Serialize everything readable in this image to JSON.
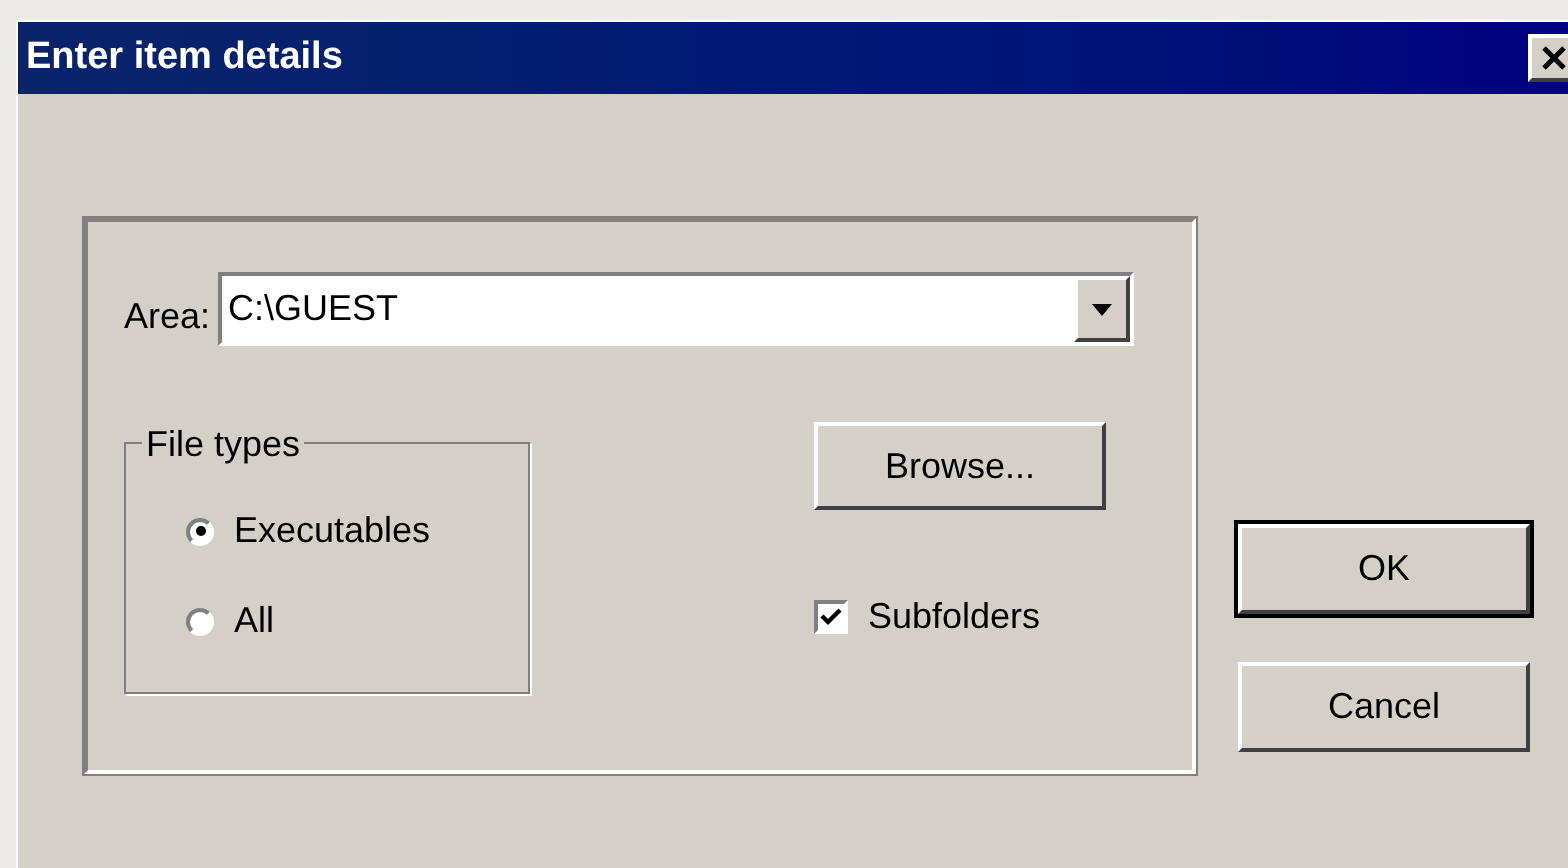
{
  "window": {
    "title": "Enter item details"
  },
  "area": {
    "label": "Area:",
    "value": "C:\\GUEST"
  },
  "file_types": {
    "title": "File types",
    "options": [
      {
        "label": "Executables",
        "selected": true
      },
      {
        "label": "All",
        "selected": false
      }
    ]
  },
  "browse_button": "Browse...",
  "subfolders": {
    "label": "Subfolders",
    "checked": true
  },
  "buttons": [
    {
      "label": "OK",
      "default": true
    },
    {
      "label": "Cancel",
      "default": false
    }
  ]
}
